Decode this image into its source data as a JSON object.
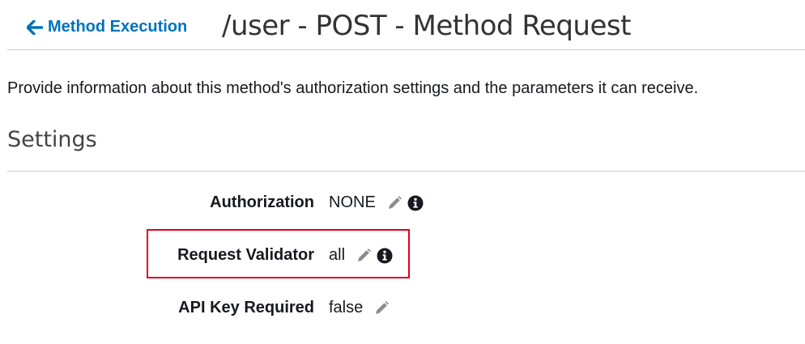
{
  "header": {
    "back_label": "Method Execution",
    "title": "/user - POST - Method Request"
  },
  "description": "Provide information about this method's authorization settings and the parameters it can receive.",
  "settings": {
    "title": "Settings",
    "rows": [
      {
        "label": "Authorization",
        "value": "NONE",
        "edit_icon": "pencil-icon",
        "info_icon": "info-circle-icon"
      },
      {
        "label": "Request Validator",
        "value": "all",
        "edit_icon": "pencil-icon",
        "info_icon": "info-circle-icon",
        "highlighted": true
      },
      {
        "label": "API Key Required",
        "value": "false",
        "edit_icon": "pencil-icon"
      }
    ]
  },
  "colors": {
    "link": "#0073bb",
    "highlight_border": "#e4001b",
    "divider": "#cccccc"
  }
}
